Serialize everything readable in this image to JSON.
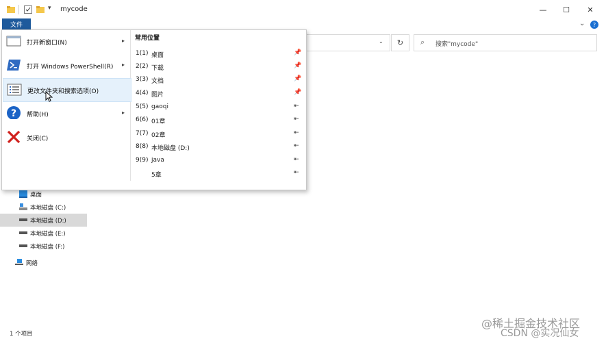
{
  "window": {
    "title": "mycode",
    "minimize_label": "—",
    "maximize_label": "☐",
    "close_label": "✕"
  },
  "ribbon": {
    "file_tab": "文件",
    "expand_icon": "⌄",
    "help_icon": "?"
  },
  "address": {
    "dropdown_icon": "⌄",
    "refresh_icon": "↻"
  },
  "search": {
    "placeholder": "搜索\"mycode\""
  },
  "file_menu": {
    "items": [
      {
        "label": "打开新窗口(N)",
        "icon": "window-icon",
        "has_submenu": true
      },
      {
        "label": "打开 Windows PowerShell(R)",
        "icon": "powershell-icon",
        "has_submenu": true
      },
      {
        "label": "更改文件夹和搜索选项(O)",
        "icon": "options-icon",
        "has_submenu": false
      },
      {
        "label": "帮助(H)",
        "icon": "help-icon",
        "has_submenu": true
      },
      {
        "label": "关闭(C)",
        "icon": "close-x-icon",
        "has_submenu": false
      }
    ],
    "submenu_arrow": "▸",
    "recent_title": "常用位置",
    "recent_places": [
      {
        "num": "1(1)",
        "label": "桌面",
        "pin": "pinned"
      },
      {
        "num": "2(2)",
        "label": "下载",
        "pin": "pinned"
      },
      {
        "num": "3(3)",
        "label": "文档",
        "pin": "pinned"
      },
      {
        "num": "4(4)",
        "label": "图片",
        "pin": "pinned"
      },
      {
        "num": "5(5)",
        "label": "gaoqi",
        "pin": "unpinned"
      },
      {
        "num": "6(6)",
        "label": "01章",
        "pin": "unpinned"
      },
      {
        "num": "7(7)",
        "label": "02章",
        "pin": "unpinned"
      },
      {
        "num": "8(8)",
        "label": "本地磁盘 (D:)",
        "pin": "unpinned"
      },
      {
        "num": "9(9)",
        "label": "java",
        "pin": "unpinned"
      },
      {
        "num": "",
        "label": "5章",
        "pin": "unpinned"
      }
    ],
    "pinned_glyph": "📌",
    "unpinned_glyph": "⇤"
  },
  "navigation": [
    {
      "label": "桌面",
      "icon": "desktop-icon",
      "selected": false
    },
    {
      "label": "本地磁盘 (C:)",
      "icon": "system-drive-icon",
      "selected": false
    },
    {
      "label": "本地磁盘 (D:)",
      "icon": "drive-icon",
      "selected": true
    },
    {
      "label": "本地磁盘 (E:)",
      "icon": "drive-icon",
      "selected": false
    },
    {
      "label": "本地磁盘 (F:)",
      "icon": "drive-icon",
      "selected": false
    },
    {
      "label": "网络",
      "icon": "network-icon",
      "selected": false
    }
  ],
  "status_bar": {
    "item_count": "1 个项目"
  },
  "watermark": {
    "line1": "@稀土掘金技术社区",
    "line2": "CSDN @实况仙女"
  },
  "colors": {
    "accent": "#1e5a9c",
    "menu_hover": "#e5f1fb",
    "selected_nav": "#d9d9d9"
  }
}
